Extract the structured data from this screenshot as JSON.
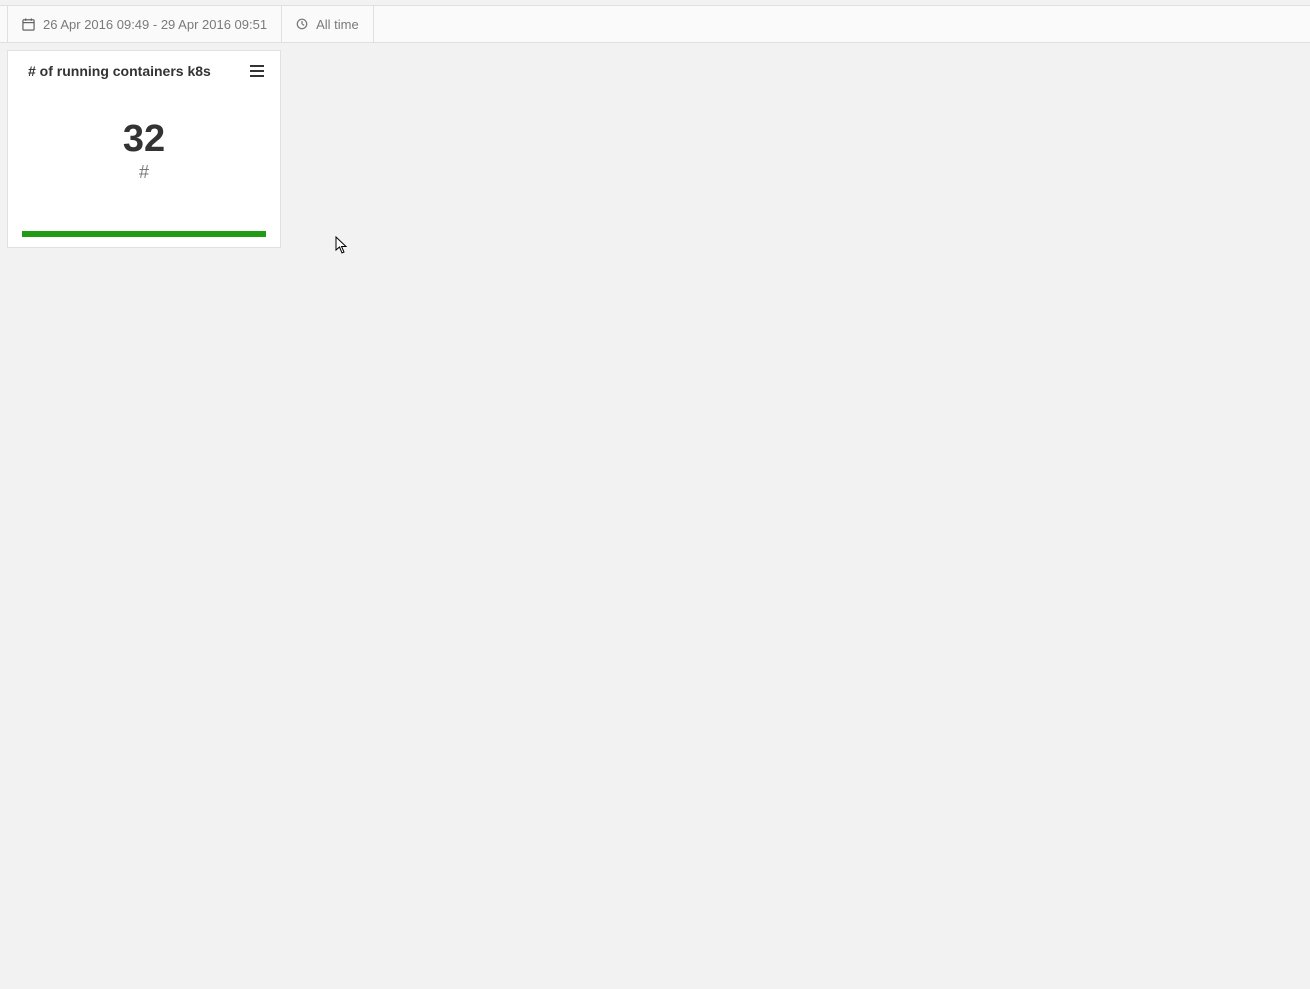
{
  "toolbar": {
    "date_range": "26 Apr 2016 09:49 - 29 Apr 2016 09:51",
    "all_time": "All time"
  },
  "widget": {
    "title": "# of running containers k8s",
    "value": "32",
    "unit": "#",
    "bar_color": "#219b13"
  }
}
